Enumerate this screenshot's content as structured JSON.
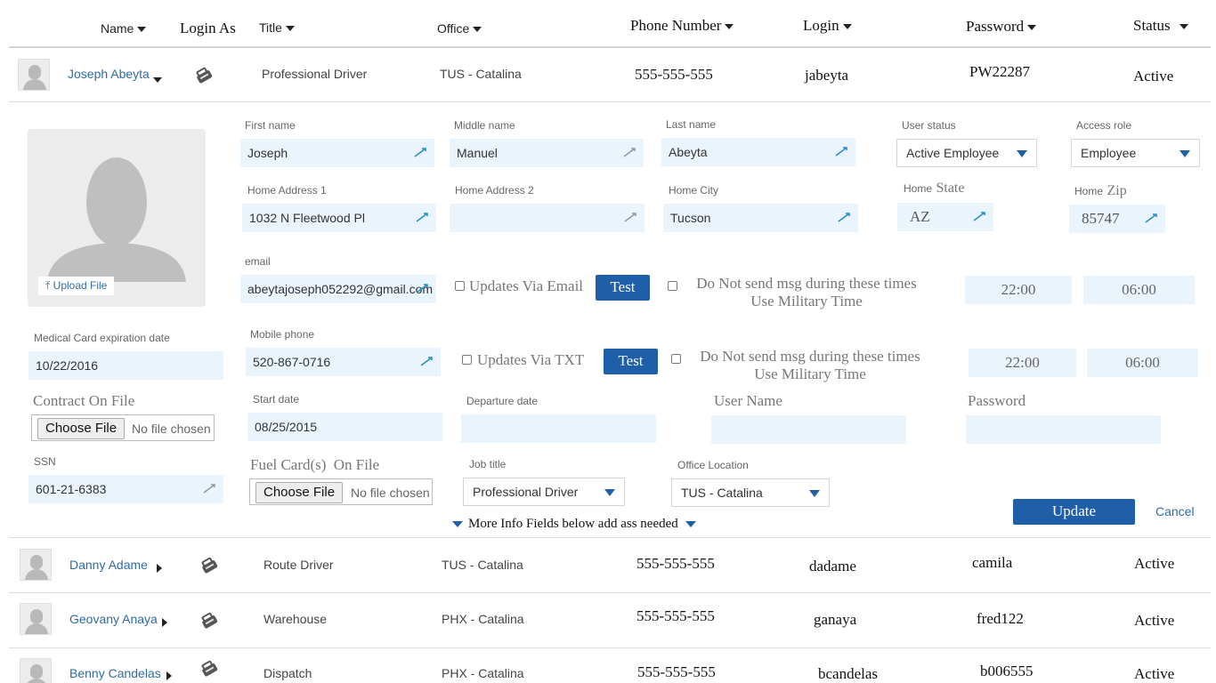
{
  "header": {
    "name": "Name",
    "login_as": "Login As",
    "title": "Title",
    "office": "Office",
    "phone": "Phone Number",
    "login": "Login",
    "password": "Password",
    "status": "Status"
  },
  "rows": [
    {
      "name": "Joseph Abeyta",
      "title": "Professional Driver",
      "office": "TUS - Catalina",
      "phone": "555-555-555",
      "login": "jabeyta",
      "password": "PW22287",
      "status": "Active"
    },
    {
      "name": "Danny Adame",
      "title": "Route Driver",
      "office": "TUS - Catalina",
      "phone": "555-555-555",
      "login": "dadame",
      "password": "camila",
      "status": "Active"
    },
    {
      "name": "Geovany Anaya",
      "title": "Warehouse",
      "office": "PHX - Catalina",
      "phone": "555-555-555",
      "login": "ganaya",
      "password": "fred122",
      "status": "Active"
    },
    {
      "name": "Benny Candelas",
      "title": "Dispatch",
      "office": "PHX - Catalina",
      "phone": "555-555-555",
      "login": "bcandelas",
      "password": "b006555",
      "status": "Active"
    }
  ],
  "detail": {
    "upload_label": "Upload File",
    "first_name_label": "First name",
    "first_name": "Joseph",
    "middle_name_label": "Middle name",
    "middle_name": "Manuel",
    "last_name_label": "Last name",
    "last_name": "Abeyta",
    "user_status_label": "User status",
    "user_status": "Active Employee",
    "access_role_label": "Access role",
    "access_role": "Employee",
    "home_address1_label": "Home Address 1",
    "home_address1": "1032 N Fleetwood Pl",
    "home_address2_label": "Home Address 2",
    "home_address2": "",
    "home_city_label": "Home City",
    "home_city": "Tucson",
    "home_state_label_a": "Home",
    "home_state_label_b": "State",
    "home_state": "AZ",
    "home_zip_label_a": "Home",
    "home_zip_label_b": "Zip",
    "home_zip": "85747",
    "email_label": "email",
    "email": "abeytajoseph052292@gmail.com",
    "updates_email_label": "Updates Via Email",
    "test_label": "Test",
    "dnd_line1": "Do Not send msg during these times",
    "dnd_line2": "Use Military Time",
    "email_start_time": "22:00",
    "email_end_time": "06:00",
    "medical_label": "Medical Card expiration date",
    "medical_date": "10/22/2016",
    "mobile_label": "Mobile phone",
    "mobile": "520-867-0716",
    "updates_txt_label": "Updates Via TXT",
    "txt_start_time": "22:00",
    "txt_end_time": "06:00",
    "contract_label": "Contract On File",
    "choose_file": "Choose File",
    "no_file": "No file chosen",
    "start_date_label": "Start date",
    "start_date": "08/25/2015",
    "departure_label": "Departure date",
    "departure_date": "",
    "username_label": "User Name",
    "username": "",
    "password_label": "Password",
    "password": "",
    "ssn_label": "SSN",
    "ssn": "601-21-6383",
    "fuel_card_label_a": "Fuel Card(s)",
    "fuel_card_label_b": "On File",
    "job_title_label": "Job title",
    "job_title": "Professional Driver",
    "office_location_label": "Office Location",
    "office_location": "TUS - Catalina",
    "more_info": "More Info Fields below add ass needed",
    "update_label": "Update",
    "cancel_label": "Cancel"
  },
  "colors": {
    "accent": "#1f5fa8",
    "link": "#2e6da4",
    "field_bg": "#eaf4fd"
  }
}
